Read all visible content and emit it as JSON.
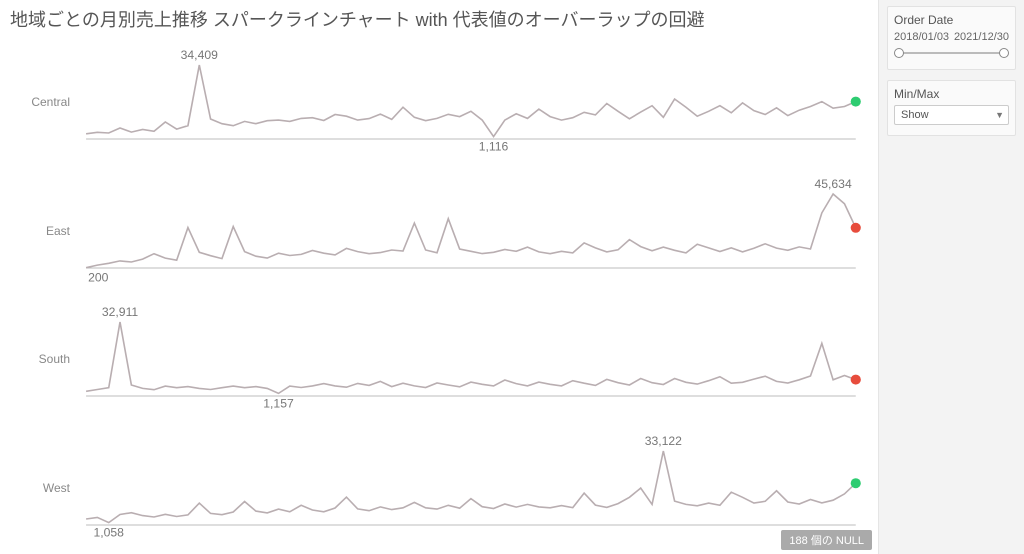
{
  "title": "地域ごとの月別売上推移 スパークラインチャート with 代表値のオーバーラップの回避",
  "sidebar": {
    "order_date": {
      "title": "Order Date",
      "start": "2018/01/03",
      "end": "2021/12/30"
    },
    "minmax": {
      "title": "Min/Max",
      "selected": "Show"
    }
  },
  "null_badge": "188 個の NULL",
  "chart_data": [
    {
      "region": "Central",
      "type": "line",
      "max_value": 34409,
      "max_label": "34,409",
      "max_index": 10,
      "min_value": 1116,
      "min_label": "1,116",
      "min_index": 36,
      "end_color": "green",
      "ylim": [
        0,
        34409
      ],
      "values": [
        2400,
        3100,
        2800,
        5100,
        3200,
        4400,
        3600,
        7900,
        4600,
        6200,
        34409,
        9300,
        7100,
        6200,
        8200,
        7100,
        8500,
        8800,
        8200,
        9600,
        9900,
        8600,
        11400,
        10600,
        8800,
        9500,
        11600,
        9100,
        14800,
        10100,
        8500,
        9600,
        11500,
        10400,
        12900,
        8800,
        1116,
        8800,
        11700,
        9600,
        13900,
        10400,
        8800,
        9900,
        12400,
        11200,
        16500,
        12900,
        9400,
        12500,
        15500,
        10100,
        18600,
        14800,
        10600,
        12900,
        15500,
        12200,
        16800,
        13200,
        11400,
        14500,
        10900,
        13400,
        15100,
        17400,
        14300,
        15100,
        17400
      ]
    },
    {
      "region": "East",
      "type": "line",
      "max_value": 45634,
      "max_label": "45,634",
      "max_index": 66,
      "min_value": 200,
      "min_label": "200",
      "min_index": 0,
      "end_color": "red",
      "ylim": [
        0,
        45634
      ],
      "values": [
        200,
        1800,
        2900,
        4400,
        3700,
        5500,
        8800,
        6100,
        4800,
        24900,
        9700,
        7600,
        5800,
        25500,
        10100,
        7300,
        6100,
        9100,
        7700,
        8400,
        10800,
        9100,
        8100,
        12100,
        10100,
        8800,
        9500,
        11100,
        10500,
        27700,
        11100,
        9400,
        30400,
        11700,
        10300,
        8900,
        9700,
        11400,
        10300,
        12900,
        9900,
        8800,
        10300,
        9300,
        15500,
        12400,
        9900,
        11200,
        17500,
        13200,
        10600,
        12900,
        10900,
        9300,
        14600,
        12400,
        10200,
        12400,
        9900,
        12200,
        14900,
        12300,
        10900,
        13000,
        11700,
        34000,
        45634,
        39600,
        24800
      ]
    },
    {
      "region": "South",
      "type": "line",
      "max_value": 32911,
      "max_label": "32,911",
      "max_index": 3,
      "min_value": 1157,
      "min_label": "1,157",
      "min_index": 17,
      "end_color": "red",
      "ylim": [
        0,
        32911
      ],
      "values": [
        2100,
        2900,
        3700,
        32911,
        4900,
        3400,
        2800,
        4400,
        3700,
        4200,
        3400,
        2900,
        3700,
        4400,
        3700,
        4200,
        3400,
        1157,
        4400,
        3800,
        4500,
        5500,
        4500,
        3900,
        5600,
        4700,
        6500,
        4200,
        5700,
        4500,
        3800,
        5800,
        4900,
        4100,
        6200,
        5200,
        4500,
        7100,
        5500,
        4500,
        6200,
        5200,
        4500,
        6800,
        5700,
        4700,
        7400,
        5900,
        4900,
        7800,
        5900,
        5100,
        7800,
        6100,
        5300,
        6800,
        8600,
        5700,
        6100,
        7500,
        8800,
        6500,
        5800,
        7200,
        8900,
        23400,
        7200,
        9100,
        7300
      ]
    },
    {
      "region": "West",
      "type": "line",
      "max_value": 33122,
      "max_label": "33,122",
      "max_index": 51,
      "min_value": 1058,
      "min_label": "1,058",
      "min_index": 2,
      "end_color": "green",
      "ylim": [
        0,
        33122
      ],
      "values": [
        2700,
        3400,
        1058,
        4700,
        5500,
        4200,
        3600,
        4800,
        3800,
        4500,
        9800,
        5200,
        4600,
        5800,
        10500,
        6200,
        5400,
        7100,
        5900,
        8800,
        6700,
        5900,
        7600,
        12500,
        7200,
        6400,
        8100,
        6900,
        7700,
        10100,
        7700,
        7100,
        8800,
        7500,
        11800,
        8200,
        7400,
        9400,
        8000,
        9200,
        8100,
        7700,
        8700,
        7800,
        14300,
        8900,
        7900,
        9600,
        12400,
        16500,
        9200,
        33122,
        10700,
        9200,
        8600,
        9800,
        8800,
        14700,
        12400,
        9800,
        10600,
        15300,
        10300,
        9400,
        11400,
        9900,
        11100,
        13900,
        18700
      ]
    }
  ]
}
